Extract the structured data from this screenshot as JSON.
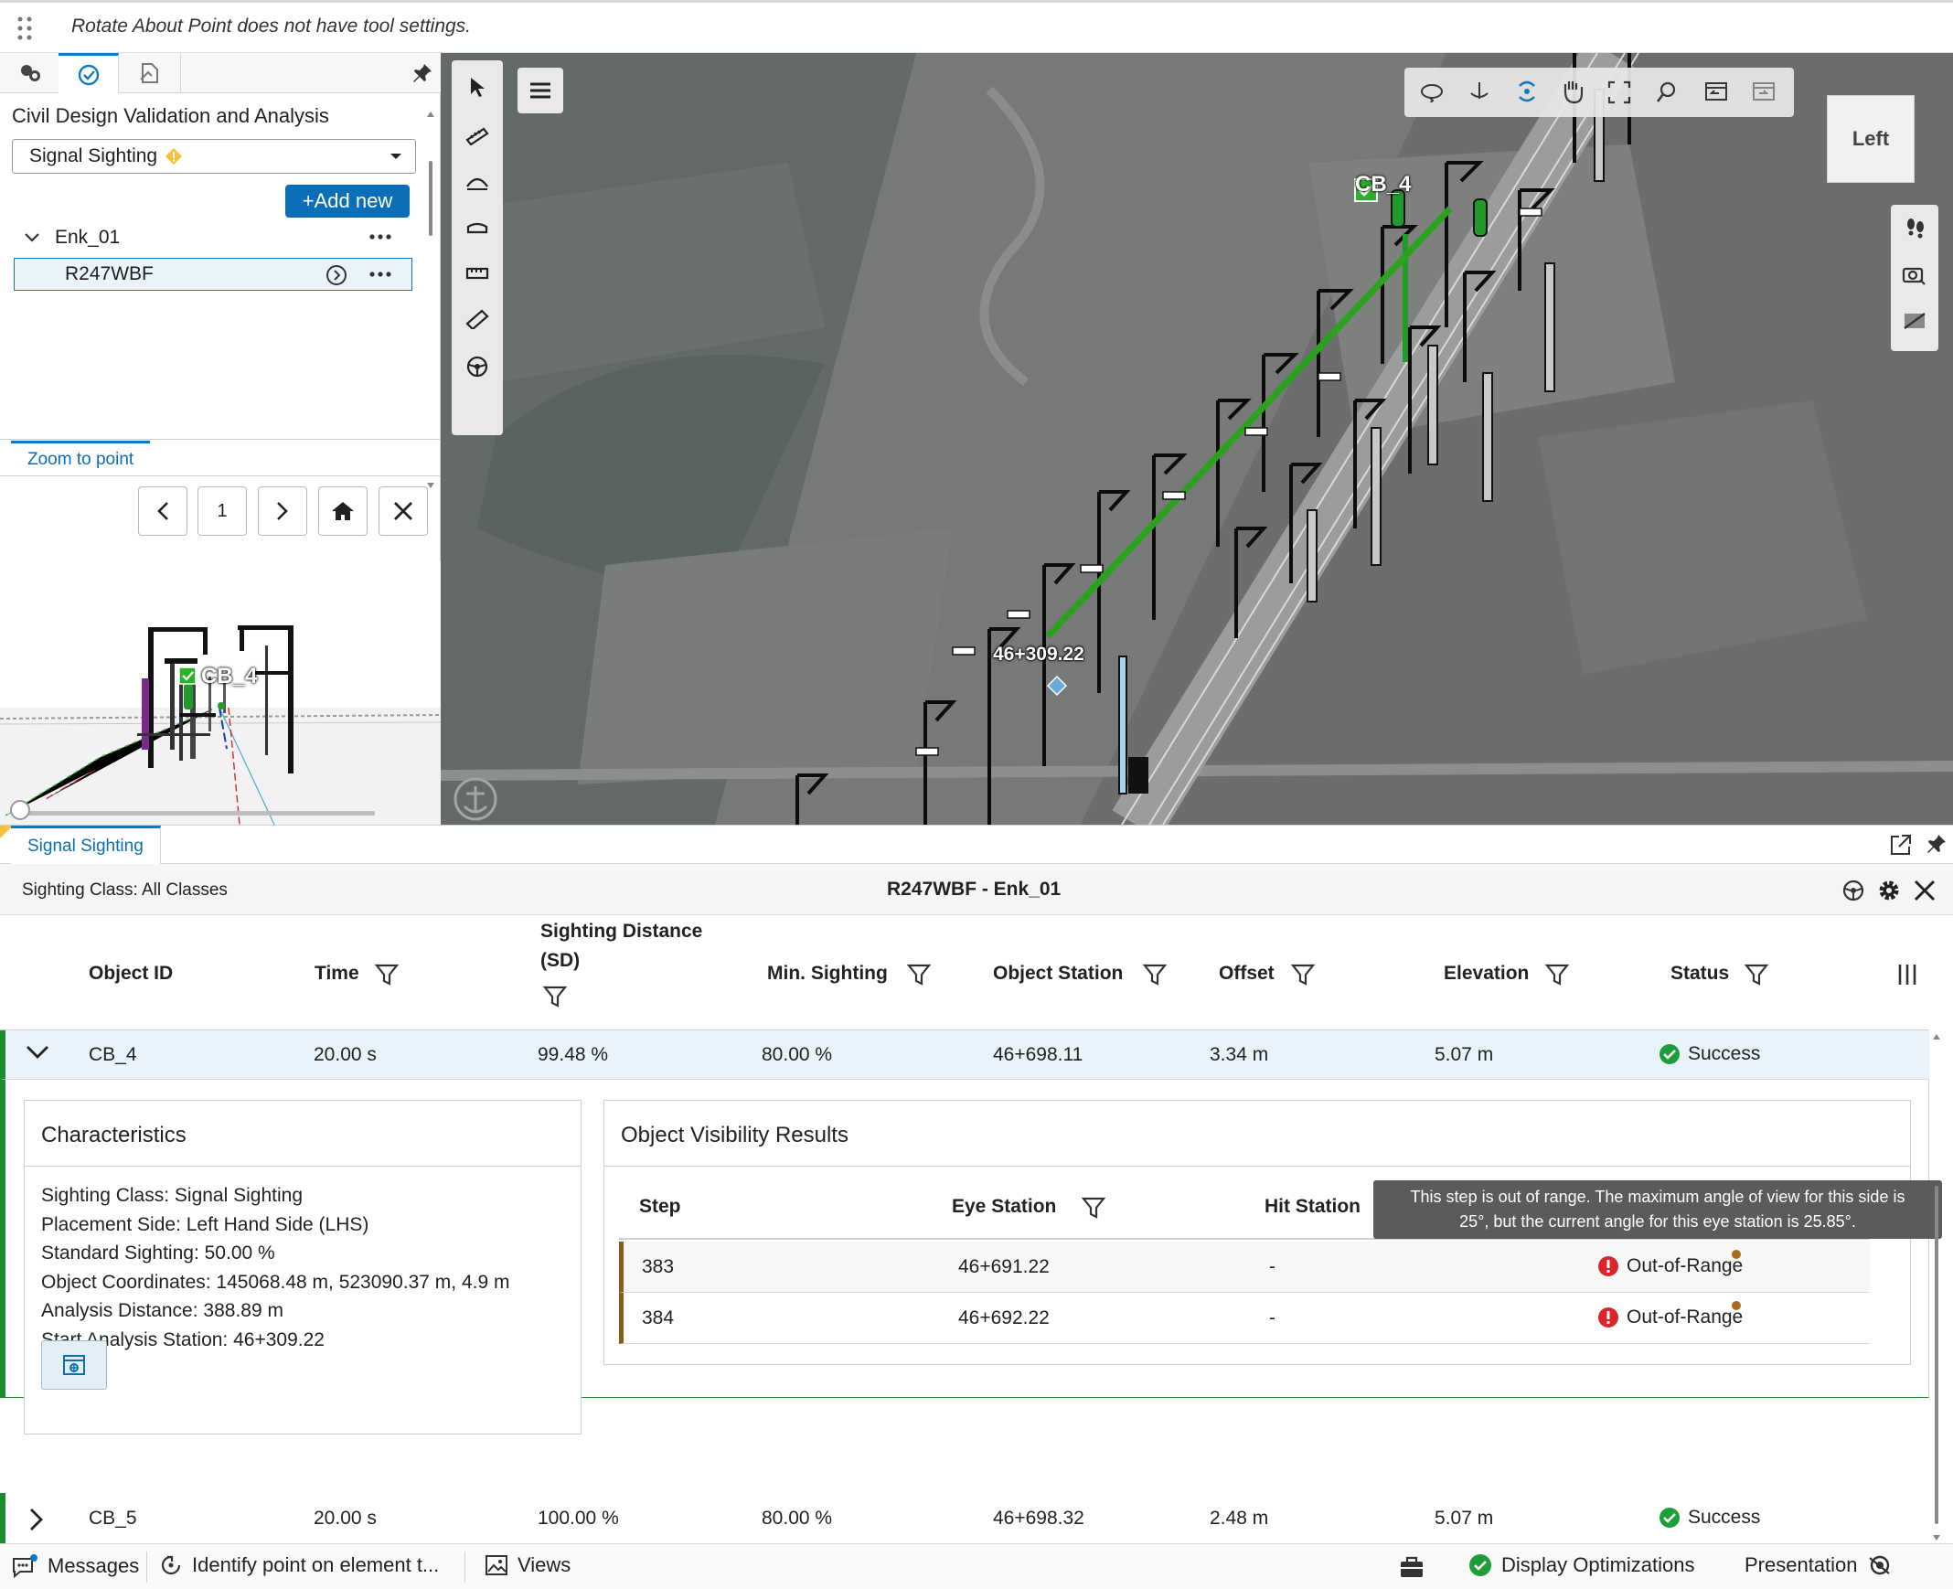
{
  "toolsettings": {
    "message": "Rotate About Point does not have tool settings."
  },
  "left_panel": {
    "title": "Civil Design Validation and Analysis",
    "analysis_type": "Signal Sighting",
    "add_new_label": "+Add new",
    "tree": {
      "group": "Enk_01",
      "item": "R247WBF"
    },
    "zoom_tab": "Zoom to point",
    "page_number": "1",
    "preview_label": "CB_4"
  },
  "viewport": {
    "cube_label": "Left",
    "label_cb4": "CB_4",
    "station_label": "46+309.22"
  },
  "bottom": {
    "tab": "Signal Sighting",
    "sighting_class": "Sighting Class: All Classes",
    "title": "R247WBF - Enk_01",
    "columns": {
      "object_id": "Object ID",
      "time": "Time",
      "sd_line1": "Sighting Distance",
      "sd_line2": "(SD)",
      "min_sighting": "Min. Sighting",
      "object_station": "Object Station",
      "offset": "Offset",
      "elevation": "Elevation",
      "status": "Status"
    },
    "rows": [
      {
        "id": "CB_4",
        "time": "20.00 s",
        "sd": "99.48 %",
        "min": "80.00 %",
        "station": "46+698.11",
        "offset": "3.34 m",
        "elevation": "5.07 m",
        "status": "Success"
      },
      {
        "id": "CB_5",
        "time": "20.00 s",
        "sd": "100.00 %",
        "min": "80.00 %",
        "station": "46+698.32",
        "offset": "2.48 m",
        "elevation": "5.07 m",
        "status": "Success"
      }
    ],
    "characteristics": {
      "title": "Characteristics",
      "lines": [
        "Sighting Class: Signal Sighting",
        "Placement Side: Left Hand Side (LHS)",
        "Standard Sighting: 50.00 %",
        "Object Coordinates: 145068.48 m, 523090.37 m, 4.9 m",
        "Analysis Distance: 388.89 m",
        "Start Analysis Station: 46+309.22"
      ]
    },
    "visibility": {
      "title": "Object Visibility Results",
      "col_step": "Step",
      "col_eye": "Eye Station",
      "col_hit": "Hit Station",
      "rows": [
        {
          "step": "383",
          "eye": "46+691.22",
          "hit": "-",
          "status": "Out-of-Range"
        },
        {
          "step": "384",
          "eye": "46+692.22",
          "hit": "-",
          "status": "Out-of-Range"
        }
      ],
      "tooltip_line1": "This step is out of range. The maximum angle of view for this side is",
      "tooltip_line2": "25°, but the current angle for this eye station is 25.85°."
    }
  },
  "statusbar": {
    "messages": "Messages",
    "identify": "Identify point on element t...",
    "views": "Views",
    "display_opt": "Display Optimizations",
    "presentation": "Presentation"
  },
  "colors": {
    "accent": "#0b6fb8",
    "success": "#1e9e3a",
    "error": "#d9262c",
    "track_line": "#2aa21d"
  }
}
